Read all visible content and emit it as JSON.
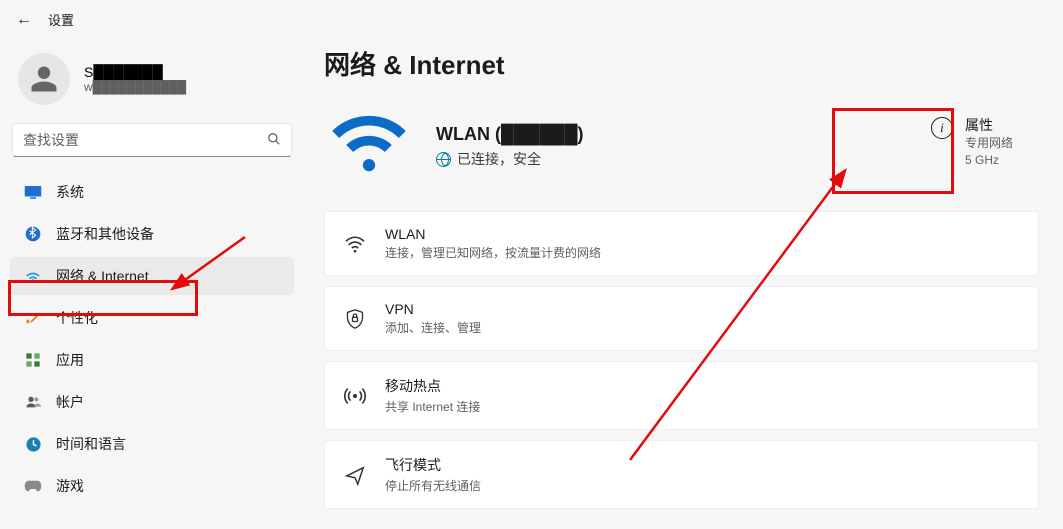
{
  "header": {
    "title": "设置"
  },
  "user": {
    "name": "S███████",
    "email": "w███████████"
  },
  "search": {
    "placeholder": "查找设置"
  },
  "sidebar": {
    "items": [
      {
        "label": "系统"
      },
      {
        "label": "蓝牙和其他设备"
      },
      {
        "label": "网络 & Internet"
      },
      {
        "label": "个性化"
      },
      {
        "label": "应用"
      },
      {
        "label": "帐户"
      },
      {
        "label": "时间和语言"
      },
      {
        "label": "游戏"
      }
    ]
  },
  "main": {
    "title": "网络 & Internet",
    "hero": {
      "ssid_label": "WLAN (██████)",
      "status": "已连接，安全"
    },
    "properties": {
      "title": "属性",
      "line1": "专用网络",
      "line2": "5 GHz"
    },
    "rows": [
      {
        "title": "WLAN",
        "subtitle": "连接，管理已知网络，按流量计费的网络"
      },
      {
        "title": "VPN",
        "subtitle": "添加、连接、管理"
      },
      {
        "title": "移动热点",
        "subtitle": "共享 Internet 连接"
      },
      {
        "title": "飞行模式",
        "subtitle": "停止所有无线通信"
      }
    ]
  }
}
